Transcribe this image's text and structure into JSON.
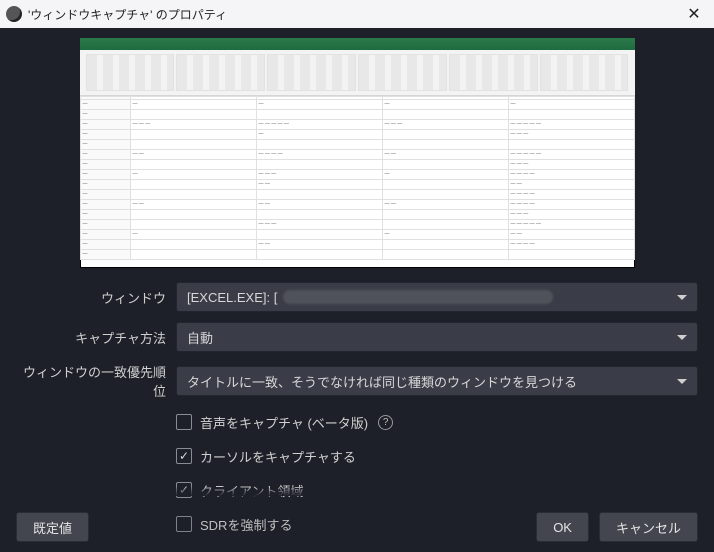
{
  "titlebar": {
    "title": "'ウィンドウキャプチャ' のプロパティ"
  },
  "form": {
    "window": {
      "label": "ウィンドウ",
      "value": "[EXCEL.EXE]: ["
    },
    "capture_method": {
      "label": "キャプチャ方法",
      "value": "自動"
    },
    "match_priority": {
      "label": "ウィンドウの一致優先順位",
      "value": "タイトルに一致、そうでなければ同じ種類のウィンドウを見つける"
    },
    "checks": {
      "audio": {
        "label": "音声をキャプチャ (ベータ版)",
        "checked": false,
        "help": true
      },
      "cursor": {
        "label": "カーソルをキャプチャする",
        "checked": true
      },
      "client": {
        "label": "クライアント領域",
        "checked": true
      },
      "sdr": {
        "label": "SDRを強制する",
        "checked": false
      }
    }
  },
  "buttons": {
    "defaults": "既定値",
    "ok": "OK",
    "cancel": "キャンセル"
  },
  "icons": {
    "help": "?"
  }
}
